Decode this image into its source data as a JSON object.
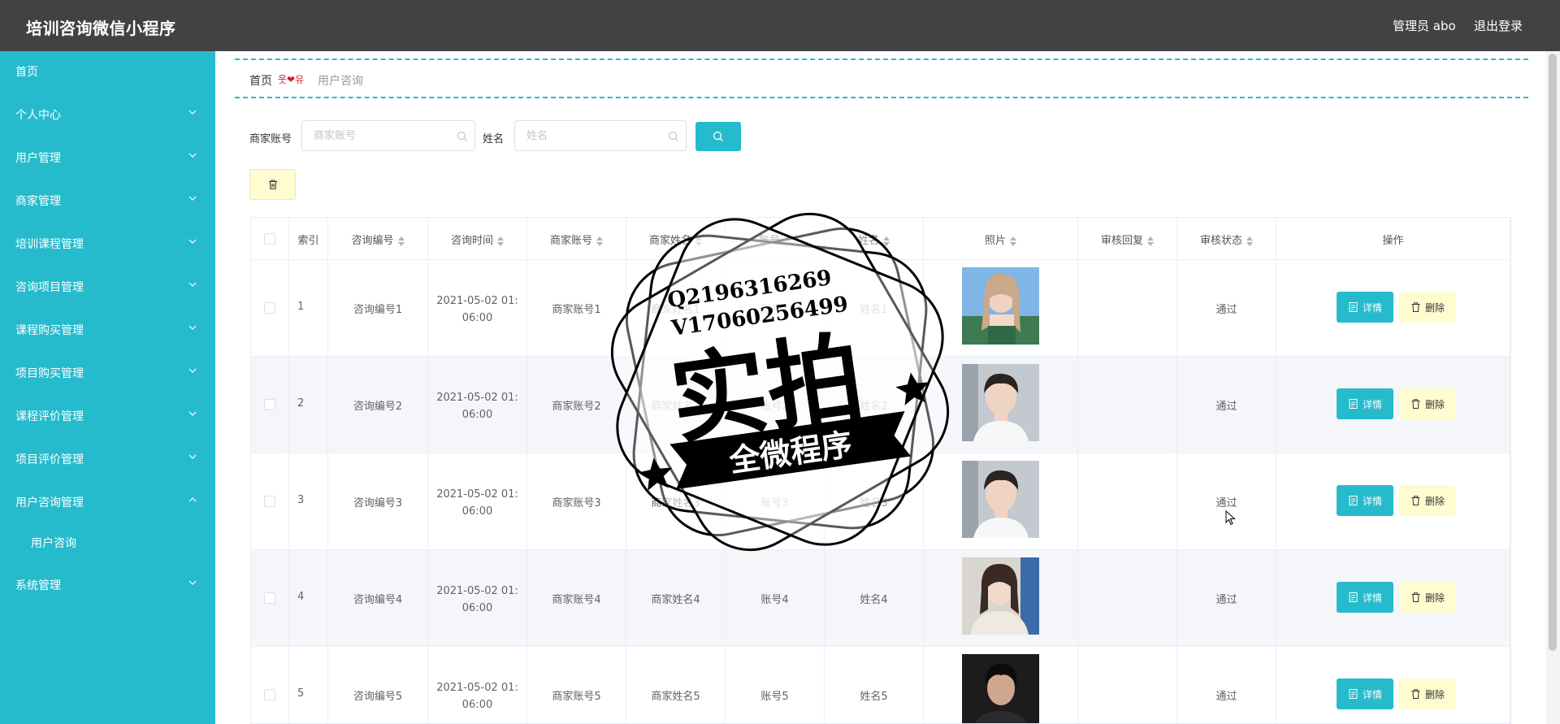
{
  "app": {
    "title": "培训咨询微信小程序"
  },
  "header": {
    "admin_label": "管理员 abo",
    "logout": "退出登录"
  },
  "sidebar": {
    "items": [
      {
        "label": "首页",
        "chevron": "none"
      },
      {
        "label": "个人中心",
        "chevron": "down"
      },
      {
        "label": "用户管理",
        "chevron": "down"
      },
      {
        "label": "商家管理",
        "chevron": "down"
      },
      {
        "label": "培训课程管理",
        "chevron": "down"
      },
      {
        "label": "咨询项目管理",
        "chevron": "down"
      },
      {
        "label": "课程购买管理",
        "chevron": "down"
      },
      {
        "label": "项目购买管理",
        "chevron": "down"
      },
      {
        "label": "课程评价管理",
        "chevron": "down"
      },
      {
        "label": "项目评价管理",
        "chevron": "down"
      },
      {
        "label": "用户咨询管理",
        "chevron": "up"
      },
      {
        "label": "用户咨询",
        "chevron": "none"
      },
      {
        "label": "系统管理",
        "chevron": "down"
      }
    ]
  },
  "breadcrumb": {
    "home": "首页",
    "separator": "웃❤유",
    "current": "用户咨询"
  },
  "search": {
    "merchant_label": "商家账号",
    "merchant_placeholder": "商家账号",
    "name_label": "姓名",
    "name_placeholder": "姓名"
  },
  "table": {
    "columns": [
      "索引",
      "咨询编号",
      "咨询时间",
      "商家账号",
      "商家姓名",
      "账号",
      "姓名",
      "照片",
      "审核回复",
      "审核状态",
      "操作"
    ],
    "detail_label": "详情",
    "delete_label": "删除",
    "rows": [
      {
        "index": "1",
        "code": "咨询编号1",
        "time_line1": "2021-05-02 01:",
        "time_line2": "06:00",
        "merchant_account": "商家账号1",
        "merchant_name": "商家姓名1",
        "account": "账号1",
        "name": "姓名1",
        "reply": "",
        "status": "通过"
      },
      {
        "index": "2",
        "code": "咨询编号2",
        "time_line1": "2021-05-02 01:",
        "time_line2": "06:00",
        "merchant_account": "商家账号2",
        "merchant_name": "商家姓名2",
        "account": "账号2",
        "name": "姓名2",
        "reply": "",
        "status": "通过"
      },
      {
        "index": "3",
        "code": "咨询编号3",
        "time_line1": "2021-05-02 01:",
        "time_line2": "06:00",
        "merchant_account": "商家账号3",
        "merchant_name": "商家姓名3",
        "account": "账号3",
        "name": "姓名3",
        "reply": "",
        "status": "通过"
      },
      {
        "index": "4",
        "code": "咨询编号4",
        "time_line1": "2021-05-02 01:",
        "time_line2": "06:00",
        "merchant_account": "商家账号4",
        "merchant_name": "商家姓名4",
        "account": "账号4",
        "name": "姓名4",
        "reply": "",
        "status": "通过"
      },
      {
        "index": "5",
        "code": "咨询编号5",
        "time_line1": "2021-05-02 01:",
        "time_line2": "06:00",
        "merchant_account": "商家账号5",
        "merchant_name": "商家姓名5",
        "account": "账号5",
        "name": "姓名5",
        "reply": "",
        "status": "通过"
      }
    ]
  },
  "watermark": {
    "line1": "Q2196316269",
    "line2": "V17060256499",
    "big": "实拍",
    "ribbon": "全微程序"
  },
  "colors": {
    "accent": "#26bbcc",
    "header": "#424242",
    "warn_bg": "#fffcd0",
    "stripe": "#f4f6fa"
  },
  "icons": {
    "search": "search-icon",
    "delete": "trash-icon",
    "detail": "document-icon",
    "chevron_down": "chevron-down-icon",
    "chevron_up": "chevron-up-icon"
  }
}
